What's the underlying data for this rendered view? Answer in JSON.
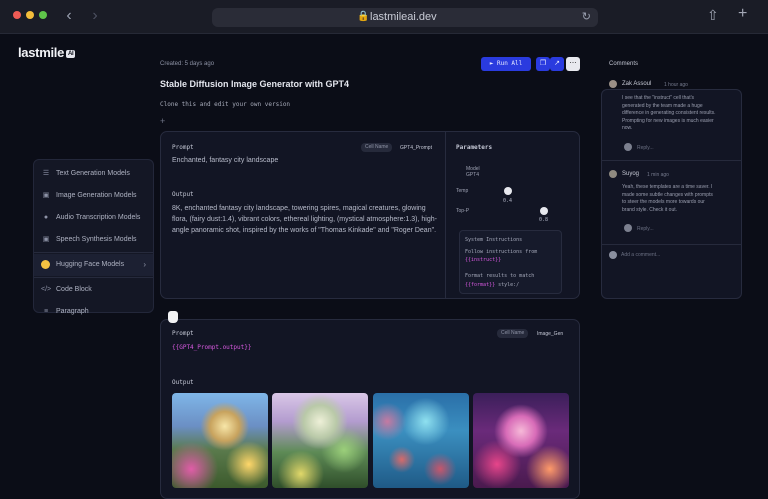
{
  "browser": {
    "url": "lastmileai.dev"
  },
  "app": {
    "logo": "lastmile",
    "logo_badge": "AI"
  },
  "menu": {
    "items": [
      {
        "label": "Text Generation Models",
        "icon": "text-icon"
      },
      {
        "label": "Image Generation Models",
        "icon": "image-icon"
      },
      {
        "label": "Audio Transcription Models",
        "icon": "mic-icon"
      },
      {
        "label": "Speech Synthesis Models",
        "icon": "speaker-icon"
      },
      {
        "label": "Hugging Face Models",
        "icon": "hugging-face-icon"
      },
      {
        "label": "Code Block",
        "icon": "code-icon"
      },
      {
        "label": "Paragraph",
        "icon": "paragraph-icon"
      }
    ]
  },
  "header": {
    "created": "Created: 5 days ago",
    "title": "Stable Diffusion Image Generator with GPT4",
    "subtitle": "Clone this and edit your own version",
    "run_all": "Run All"
  },
  "cell1": {
    "prompt_label": "Prompt",
    "cell_name_chip": "Cell Name",
    "cell_name": "GPT4_Prompt",
    "prompt_text": "Enchanted, fantasy city landscape",
    "output_label": "Output",
    "output_text_1": "8K, enchanted fantasy city landscape, towering spires, magical creatures, glowing",
    "output_text_2": "flora, (fairy dust:1.4), vibrant colors, ethereal lighting, (mystical atmosphere:1.3), high-",
    "output_text_3": "angle panoramic shot, inspired by the works of \"Thomas Kinkade\" and \"Roger Dean\".",
    "parameters_label": "Parameters",
    "model_label_1": "Model",
    "model_label_2": "GPT4",
    "temp_label": "Temp",
    "temp_value": "0.4",
    "top_p_label": "Top-P",
    "top_p_value": "0.8",
    "system_instructions_label": "System Instructions",
    "sys_line_1": "Follow instructions from",
    "sys_var_1": "{{instruct}}",
    "sys_line_2": "Format results to match",
    "sys_var_2": "{{format}}",
    "sys_line_2_tail": "style:/"
  },
  "cell2": {
    "prompt_label": "Prompt",
    "cell_name_chip": "Cell Name",
    "cell_name": "Image_Gen",
    "prompt_text": "{{GPT4_Prompt.output}}",
    "output_label": "Output"
  },
  "comments": {
    "title": "Comments",
    "items": [
      {
        "name": "Zak Assoul",
        "time": "1 hour ago",
        "body_1": "I see that the \"instruct\" cell that's",
        "body_2": "generated by the team made a huge",
        "body_3": "difference in generating consistent results.",
        "body_4": "Prompting for new images is much easier",
        "body_5": "now.",
        "reply": "Reply..."
      },
      {
        "name": "Suyog",
        "time": "1 min ago",
        "body_1": "Yeah, these templates are a time saver. I",
        "body_2": "made some subtle changes with prompts",
        "body_3": "to steer the models more towards our",
        "body_4": "brand style. Check it out.",
        "reply": "Reply..."
      }
    ],
    "add_placeholder": "Add a comment..."
  },
  "colors": {
    "accent": "#2a3bdf",
    "variable": "#d859e0",
    "background": "#0b0d17"
  }
}
